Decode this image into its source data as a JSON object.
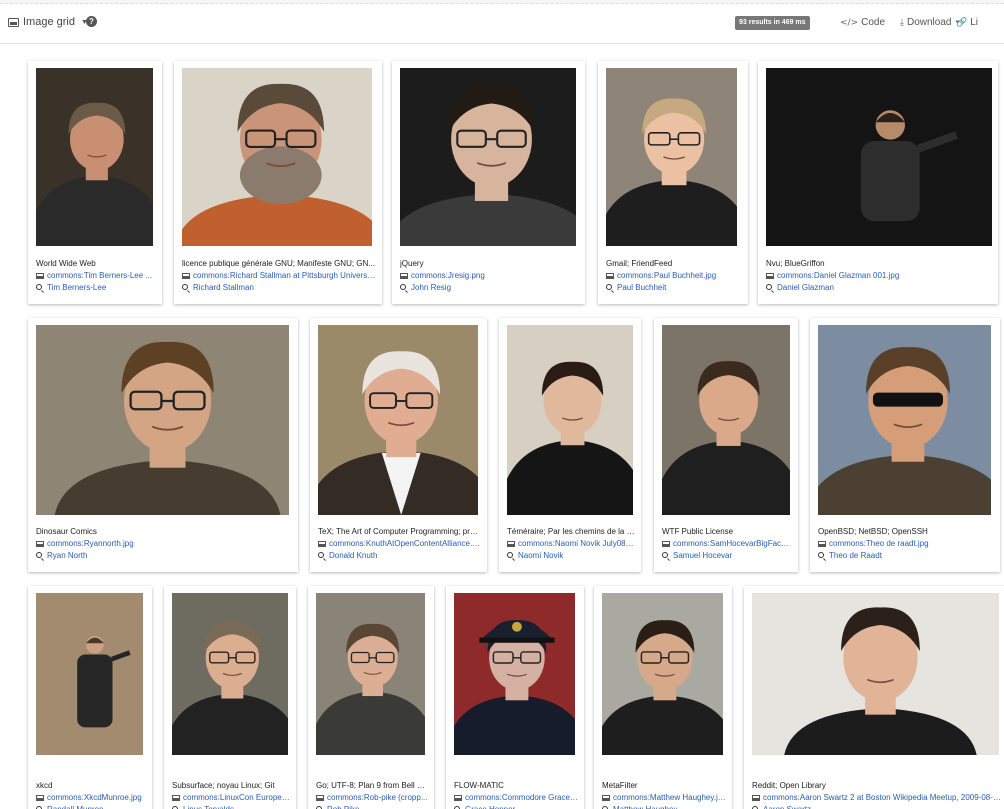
{
  "toolbar": {
    "view_label": "Image grid",
    "results_badge": "93 results in 469 ms",
    "code_label": "Code",
    "download_label": "Download",
    "link_label": "Li"
  },
  "cards": [
    {
      "title": "World Wide Web",
      "file": "commons:Tim Berners-Lee ...",
      "person": "Tim Berners-Lee"
    },
    {
      "title": "licence publique générale GNU; Manifeste GNU; GN...",
      "file": "commons:Richard Stallman at Pittsburgh University...",
      "person": "Richard Stallman"
    },
    {
      "title": "jQuery",
      "file": "commons:Jresig.png",
      "person": "John Resig"
    },
    {
      "title": "Gmail; FriendFeed",
      "file": "commons:Paul Buchheit.jpg",
      "person": "Paul Buchheit"
    },
    {
      "title": "Nvu; BlueGriffon",
      "file": "commons:Daniel Glazman 001.jpg",
      "person": "Daniel Glazman"
    },
    {
      "title": "Dinosaur Comics",
      "file": "commons:Ryannorth.jpg",
      "person": "Ryan North"
    },
    {
      "title": "TeX; The Art of Computer Programming; pro...",
      "file": "commons:KnuthAtOpenContentAlliance.jpg",
      "person": "Donald Knuth"
    },
    {
      "title": "Téméraire; Par les chemins de la s...",
      "file": "commons:Naomi Novik July08.jpg",
      "person": "Naomi Novik"
    },
    {
      "title": "WTF Public License",
      "file": "commons:SamHocevarBigFace....",
      "person": "Samuel Hocevar"
    },
    {
      "title": "OpenBSD; NetBSD; OpenSSH",
      "file": "commons:Theo de raadt.jpg",
      "person": "Theo de Raadt"
    },
    {
      "title": "xkcd",
      "file": "commons:XkcdMunroe.jpg",
      "person": "Randall Munroe"
    },
    {
      "title": "Subsurface; noyau Linux; Git",
      "file": "commons:LinuxCon Europe ...",
      "person": "Linus Torvalds"
    },
    {
      "title": "Go; UTF-8; Plan 9 from Bell L...",
      "file": "commons:Rob-pike (cropp...",
      "person": "Rob Pike"
    },
    {
      "title": "FLOW-MATIC",
      "file": "commons:Commodore Grace ...",
      "person": "Grace Hopper"
    },
    {
      "title": "MetaFilter",
      "file": "commons:Matthew Haughey.jpg",
      "person": "Matthew Haughey"
    },
    {
      "title": "Reddit; Open Library",
      "file": "commons:Aaron Swartz 2 at Boston Wikipedia Meetup, 2009-08-18...",
      "person": "Aaron Swartz"
    }
  ]
}
